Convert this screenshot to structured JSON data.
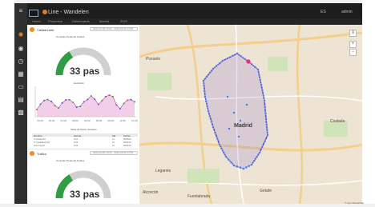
{
  "header": {
    "app_title": "Line - Wandelen",
    "right_items": [
      "ES",
      "admin"
    ]
  },
  "breadcrumb": [
    "Home",
    "Proyectos",
    "Dashboards",
    "Madrid",
    "2024"
  ],
  "rail_icons": [
    "menu-icon",
    "sun-icon",
    "user-icon",
    "clock-icon",
    "grid-icon",
    "monitor-icon",
    "table-icon",
    "apps-icon"
  ],
  "card1": {
    "title": "Calidad aire",
    "pill_text": "2024-03-05 10:00 - 2024-03-05 10:59",
    "gauge_title": "Contador Peatonal Totales",
    "gauge": {
      "value": 0.33,
      "label": "33 pas"
    },
    "timeline_title": "Evolución",
    "timeline_xlabels": [
      "15:00",
      "18:00",
      "21:00",
      "00:00",
      "03:00",
      "06:00",
      "09:00",
      "12:00",
      "15:00"
    ],
    "table_title": "Tabla de Datos (Listado)",
    "table_headers": [
      "Nombre",
      "Sensor",
      "Val",
      "Fecha"
    ],
    "table_rows": [
      [
        "C/ Alcalá 245",
        "S-01",
        "12",
        "05/03/24"
      ],
      [
        "Pº Castellana 100",
        "S-02",
        "33",
        "05/03/24"
      ],
      [
        "Gran Vía 28",
        "S-03",
        "21",
        "05/03/24"
      ]
    ]
  },
  "card2": {
    "title": "Tráfico",
    "pill_text": "2024-03-05 10:00 - 2024-03-05 10:59",
    "gauge_title": "Contador Peatonal Totales",
    "gauge": {
      "value": 0.33,
      "label": "33 pas"
    }
  },
  "map": {
    "city_label": "Madrid",
    "labels": [
      "Coslada",
      "Leganés",
      "Alcorcón",
      "Pozuelo",
      "Fuenlabrada",
      "Getafe"
    ],
    "attribution": "© OpenStreetMap"
  },
  "colors": {
    "accent": "#f08a24",
    "gauge_green": "#2f9e44",
    "gauge_grey": "#d0d0d0",
    "route": "#6a4cc7",
    "marker": "#4b7fd1"
  }
}
